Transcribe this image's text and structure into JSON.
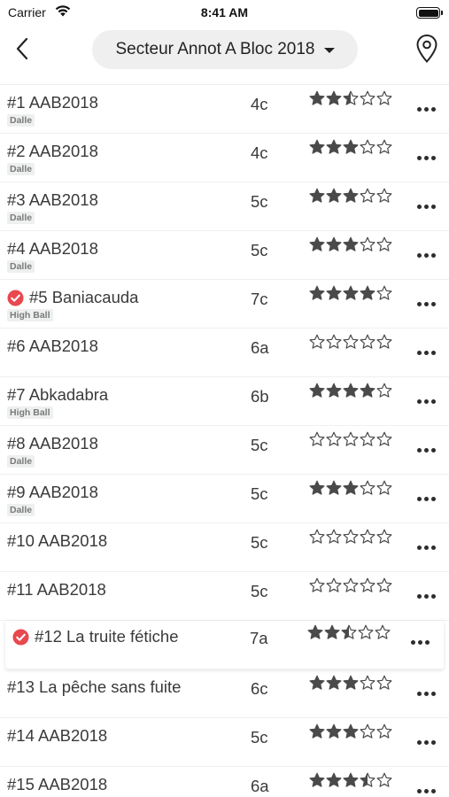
{
  "status_bar": {
    "carrier": "Carrier",
    "time": "8:41 AM"
  },
  "nav": {
    "sector_label": "Secteur Annot A Bloc 2018",
    "back_icon": "chevron-left-icon",
    "location_icon": "map-pin-icon"
  },
  "colors": {
    "star": "#4a4a4a",
    "done": "#e8484e",
    "tag_bg": "#eef0f0"
  },
  "routes": [
    {
      "name": "#1 AAB2018",
      "tag": "Dalle",
      "grade": "4c",
      "rating": 2.5,
      "done": false
    },
    {
      "name": "#2 AAB2018",
      "tag": "Dalle",
      "grade": "4c",
      "rating": 3,
      "done": false
    },
    {
      "name": "#3 AAB2018",
      "tag": "Dalle",
      "grade": "5c",
      "rating": 3,
      "done": false
    },
    {
      "name": "#4 AAB2018",
      "tag": "Dalle",
      "grade": "5c",
      "rating": 3,
      "done": false
    },
    {
      "name": "#5 Baniacauda",
      "tag": "High Ball",
      "grade": "7c",
      "rating": 4,
      "done": true
    },
    {
      "name": "#6 AAB2018",
      "tag": "",
      "grade": "6a",
      "rating": 0,
      "done": false
    },
    {
      "name": "#7 Abkadabra",
      "tag": "High Ball",
      "grade": "6b",
      "rating": 4,
      "done": false
    },
    {
      "name": "#8 AAB2018",
      "tag": "Dalle",
      "grade": "5c",
      "rating": 0,
      "done": false
    },
    {
      "name": "#9 AAB2018",
      "tag": "Dalle",
      "grade": "5c",
      "rating": 3,
      "done": false
    },
    {
      "name": "#10 AAB2018",
      "tag": "",
      "grade": "5c",
      "rating": 0,
      "done": false
    },
    {
      "name": "#11 AAB2018",
      "tag": "",
      "grade": "5c",
      "rating": 0,
      "done": false
    },
    {
      "name": "#12 La truite fétiche",
      "tag": "",
      "grade": "7a",
      "rating": 2.5,
      "done": true,
      "highlight": true
    },
    {
      "name": "#13 La pêche sans fuite",
      "tag": "",
      "grade": "6c",
      "rating": 3,
      "done": false
    },
    {
      "name": "#14 AAB2018",
      "tag": "",
      "grade": "5c",
      "rating": 3,
      "done": false
    },
    {
      "name": "#15 AAB2018",
      "tag": "",
      "grade": "6a",
      "rating": 3.5,
      "done": false
    }
  ]
}
